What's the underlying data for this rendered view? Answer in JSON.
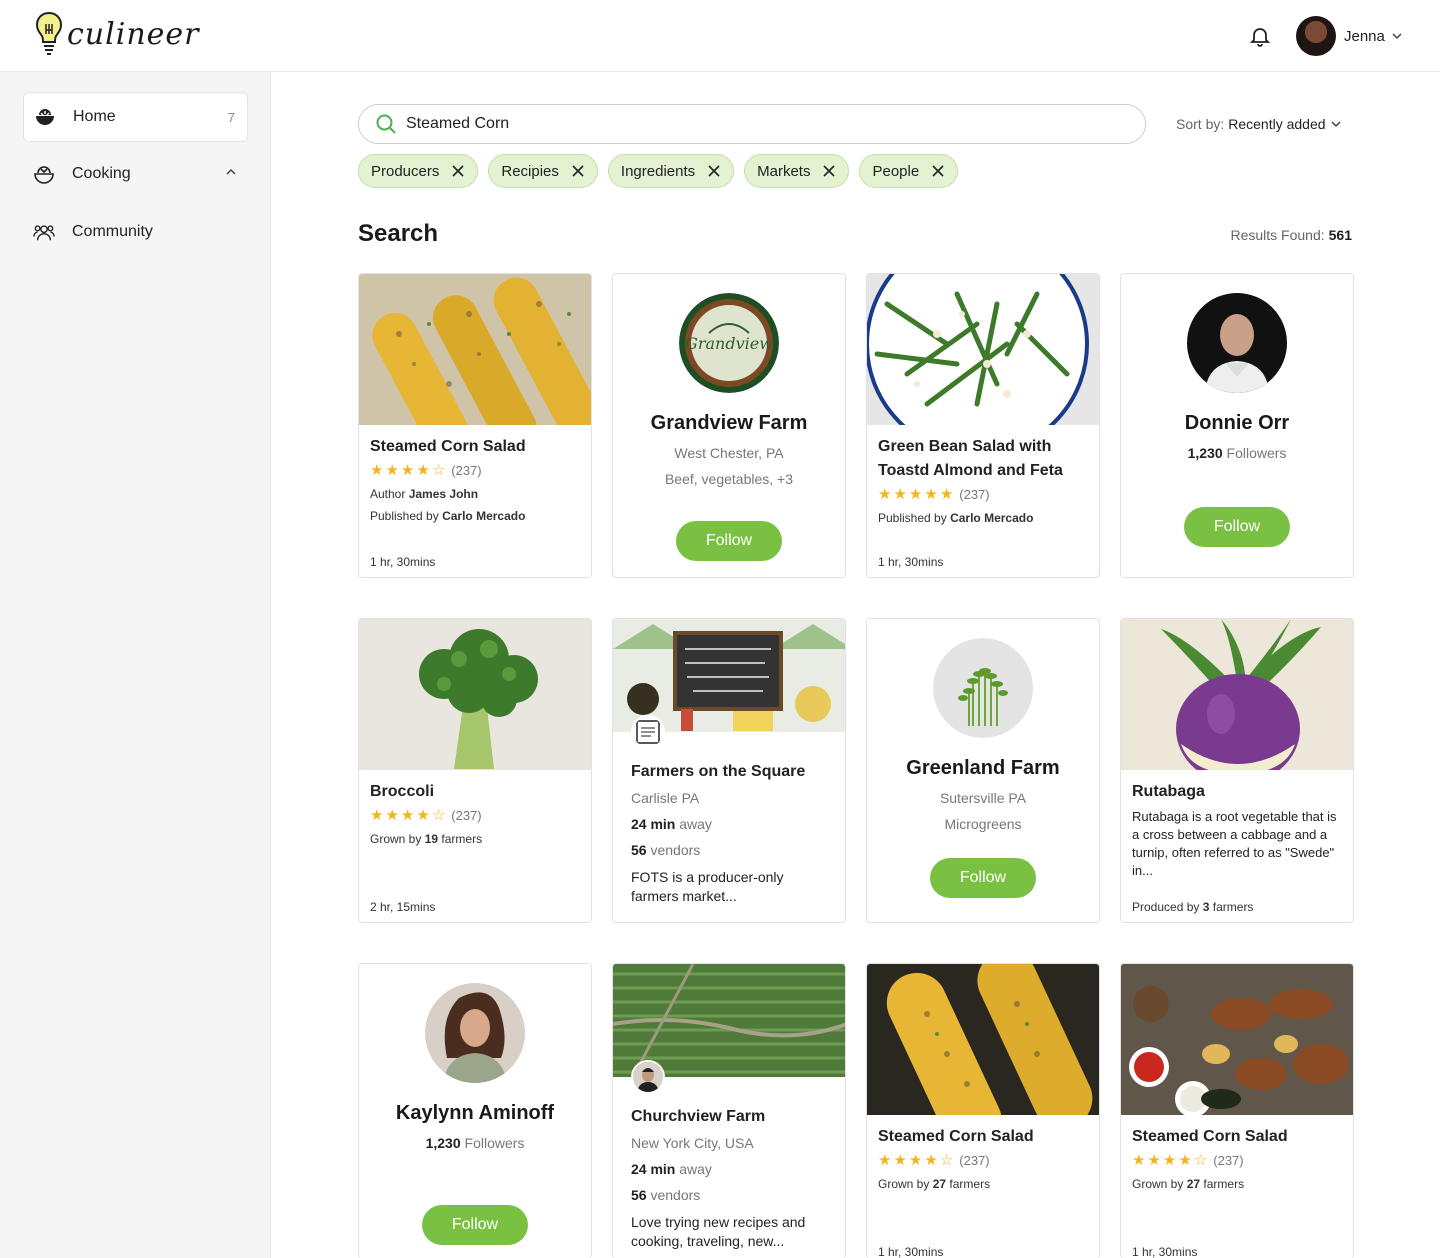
{
  "brand": {
    "name": "culineer"
  },
  "user": {
    "name": "Jenna"
  },
  "sidebar": {
    "items": [
      {
        "label": "Home",
        "count": "7"
      },
      {
        "label": "Cooking"
      },
      {
        "label": "Community"
      }
    ]
  },
  "search": {
    "value": "Steamed Corn",
    "placeholder": "Search"
  },
  "sort": {
    "label": "Sort by:",
    "value": "Recently added"
  },
  "filters": [
    "Producers",
    "Recipies",
    "Ingredients",
    "Markets",
    "People"
  ],
  "results": {
    "title": "Search",
    "found_label": "Results Found:",
    "count": "561"
  },
  "cards": [
    {
      "title": "Steamed Corn Salad",
      "rating": "(237)",
      "author_label": "Author",
      "author": "James John",
      "pub_label": "Published by",
      "publisher": "Carlo Mercado",
      "time": "1 hr, 30mins"
    },
    {
      "name": "Grandview Farm",
      "location": "West Chester, PA",
      "products": "Beef, vegetables, +3",
      "follow": "Follow",
      "logo_text": "Grandview"
    },
    {
      "title": "Green Bean Salad with Toastd Almond and Feta",
      "rating": "(237)",
      "pub_label": "Published by",
      "publisher": "Carlo Mercado",
      "time": "1 hr, 30mins"
    },
    {
      "name": "Donnie Orr",
      "followers_count": "1,230",
      "followers_label": "Followers",
      "follow": "Follow"
    },
    {
      "title": "Broccoli",
      "rating": "(237)",
      "grown_label": "Grown by",
      "grown_count": "19",
      "grown_suffix": "farmers",
      "time": "2 hr, 15mins"
    },
    {
      "name": "Farmers on the Square",
      "location": "Carlisle PA",
      "min": "24 min",
      "away": "away",
      "vendors": "56",
      "vendors_label": "vendors",
      "desc": "FOTS is a producer-only farmers market..."
    },
    {
      "name": "Greenland Farm",
      "location": "Sutersville PA",
      "products": "Microgreens",
      "follow": "Follow"
    },
    {
      "title": "Rutabaga",
      "desc": "Rutabaga is a root vegetable that is a cross between a cabbage and a turnip, often referred to as \"Swede\" in...",
      "produced_label": "Produced by",
      "produced_count": "3",
      "produced_suffix": "farmers"
    },
    {
      "name": "Kaylynn Aminoff",
      "followers_count": "1,230",
      "followers_label": "Followers",
      "follow": "Follow"
    },
    {
      "name": "Churchview Farm",
      "location": "New York City, USA",
      "min": "24 min",
      "away": "away",
      "vendors": "56",
      "vendors_label": "vendors",
      "desc": "Love trying new recipes and cooking, traveling, new..."
    },
    {
      "title": "Steamed Corn Salad",
      "rating": "(237)",
      "grown_label": "Grown by",
      "grown_count": "27",
      "grown_suffix": "farmers",
      "time": "1 hr, 30mins"
    },
    {
      "title": "Steamed Corn Salad",
      "rating": "(237)",
      "grown_label": "Grown by",
      "grown_count": "27",
      "grown_suffix": "farmers",
      "time": "1 hr, 30mins"
    }
  ],
  "colors": {
    "accent": "#7ac143",
    "chip_bg": "#e3f2d0",
    "star": "#f3b51a"
  }
}
